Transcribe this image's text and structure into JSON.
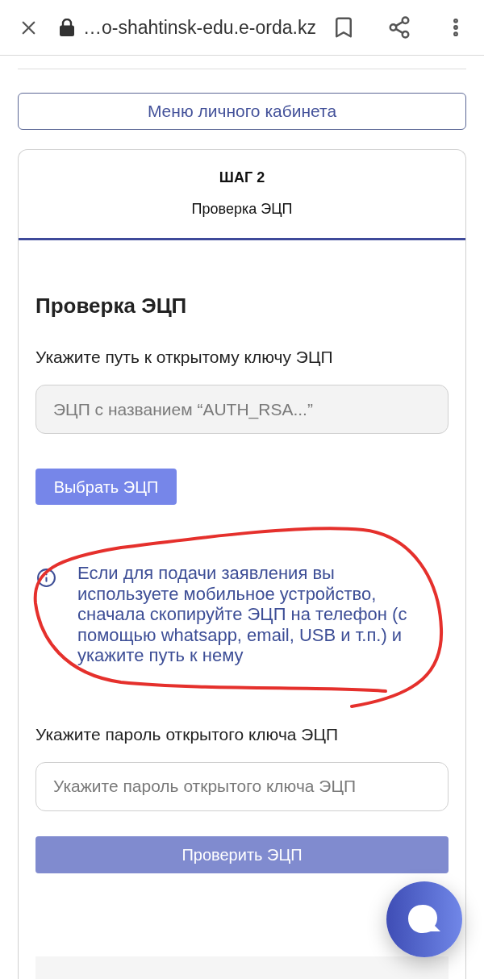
{
  "browser_bar": {
    "url": "…o-shahtinsk-edu.e-orda.kz"
  },
  "menu_button": {
    "label": "Меню личного кабинета"
  },
  "step_card": {
    "step": "ШАГ 2",
    "step_title": "Проверка ЭЦП"
  },
  "form": {
    "title": "Проверка ЭЦП",
    "key_path": {
      "label": "Укажите путь к открытому ключу ЭЦП",
      "placeholder": "ЭЦП с названием “AUTH_RSA...”",
      "disabled": true
    },
    "choose_button": {
      "label": "Выбрать ЭЦП",
      "disabled": false
    },
    "notice": {
      "text": "Если для подачи заявления вы используете мобильное устройство, сначала скопируйте ЭЦП на телефон (с помощью whatsapp, email, USB и т.п.) и укажите путь к нему",
      "circled": true
    },
    "password": {
      "label": "Укажите пароль открытого ключа ЭЦП",
      "placeholder": "Укажите пароль открытого ключа ЭЦП",
      "disabled": false
    },
    "check_button": {
      "label": "Проверить ЭЦП",
      "disabled": true
    }
  }
}
